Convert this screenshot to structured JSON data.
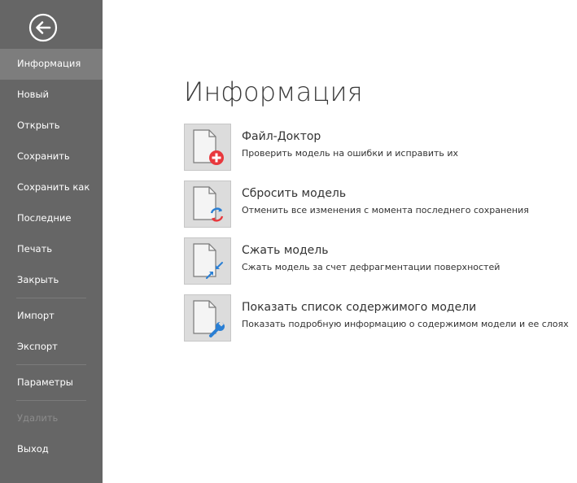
{
  "sidebar": {
    "back_icon": "back-arrow-circle-icon",
    "items": [
      {
        "label": "Информация",
        "active": true
      },
      {
        "label": "Новый"
      },
      {
        "label": "Открыть"
      },
      {
        "label": "Сохранить"
      },
      {
        "label": "Сохранить как"
      },
      {
        "label": "Последние"
      },
      {
        "label": "Печать"
      },
      {
        "label": "Закрыть"
      },
      {
        "label": "Импорт"
      },
      {
        "label": "Экспорт"
      },
      {
        "label": "Параметры"
      },
      {
        "label": "Удалить",
        "disabled": true
      },
      {
        "label": "Выход"
      }
    ]
  },
  "main": {
    "title": "Информация",
    "actions": [
      {
        "title": "Файл-Доктор",
        "desc": "Проверить модель на ошибки и исправить их",
        "icon": "document-repair-icon"
      },
      {
        "title": "Сбросить модель",
        "desc": "Отменить все изменения с момента последнего сохранения",
        "icon": "document-reset-icon"
      },
      {
        "title": "Сжать модель",
        "desc": "Сжать модель за счет дефрагментации поверхностей",
        "icon": "document-compress-icon"
      },
      {
        "title": "Показать список содержимого модели",
        "desc": "Показать подробную информацию о содержимом модели и ее слоях",
        "icon": "document-wrench-icon"
      }
    ]
  },
  "colors": {
    "sidebar_bg": "#666666",
    "sidebar_active": "#7d7d7d",
    "repair_red": "#e8383d",
    "accent_blue": "#2a7fd4"
  }
}
